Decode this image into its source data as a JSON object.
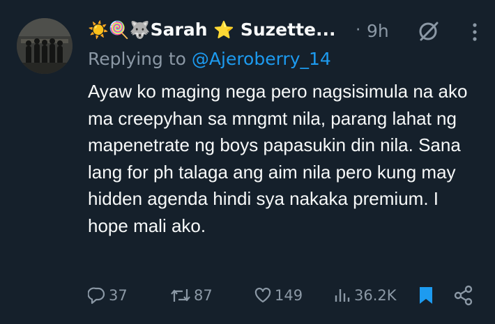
{
  "tweet": {
    "display_name_emoji": "☀️🍭🐺",
    "display_name_part1": "Sarah ",
    "display_name_star": "⭐",
    "display_name_part2": " Suzette...",
    "separator": "·",
    "time": "9h",
    "replying_prefix": "Replying to ",
    "replying_handle": "@Ajeroberry_14",
    "body": "Ayaw ko maging nega pero nagsisimula na ako ma creepyhan sa mngmt nila, parang lahat ng mapenetrate ng boys papasukin din nila. Sana lang for ph talaga ang aim nila pero kung may hidden agenda hindi sya nakaka premium. I hope mali ako."
  },
  "actions": {
    "replies": "37",
    "reposts": "87",
    "likes": "149",
    "views": "36.2K"
  },
  "colors": {
    "background": "#15202b",
    "text": "#f7f9f9",
    "muted": "#8b98a5",
    "accent": "#1d9bf0"
  },
  "icons": [
    "grok-icon",
    "more-icon",
    "reply-icon",
    "repost-icon",
    "like-icon",
    "views-icon",
    "bookmark-icon",
    "share-icon"
  ]
}
